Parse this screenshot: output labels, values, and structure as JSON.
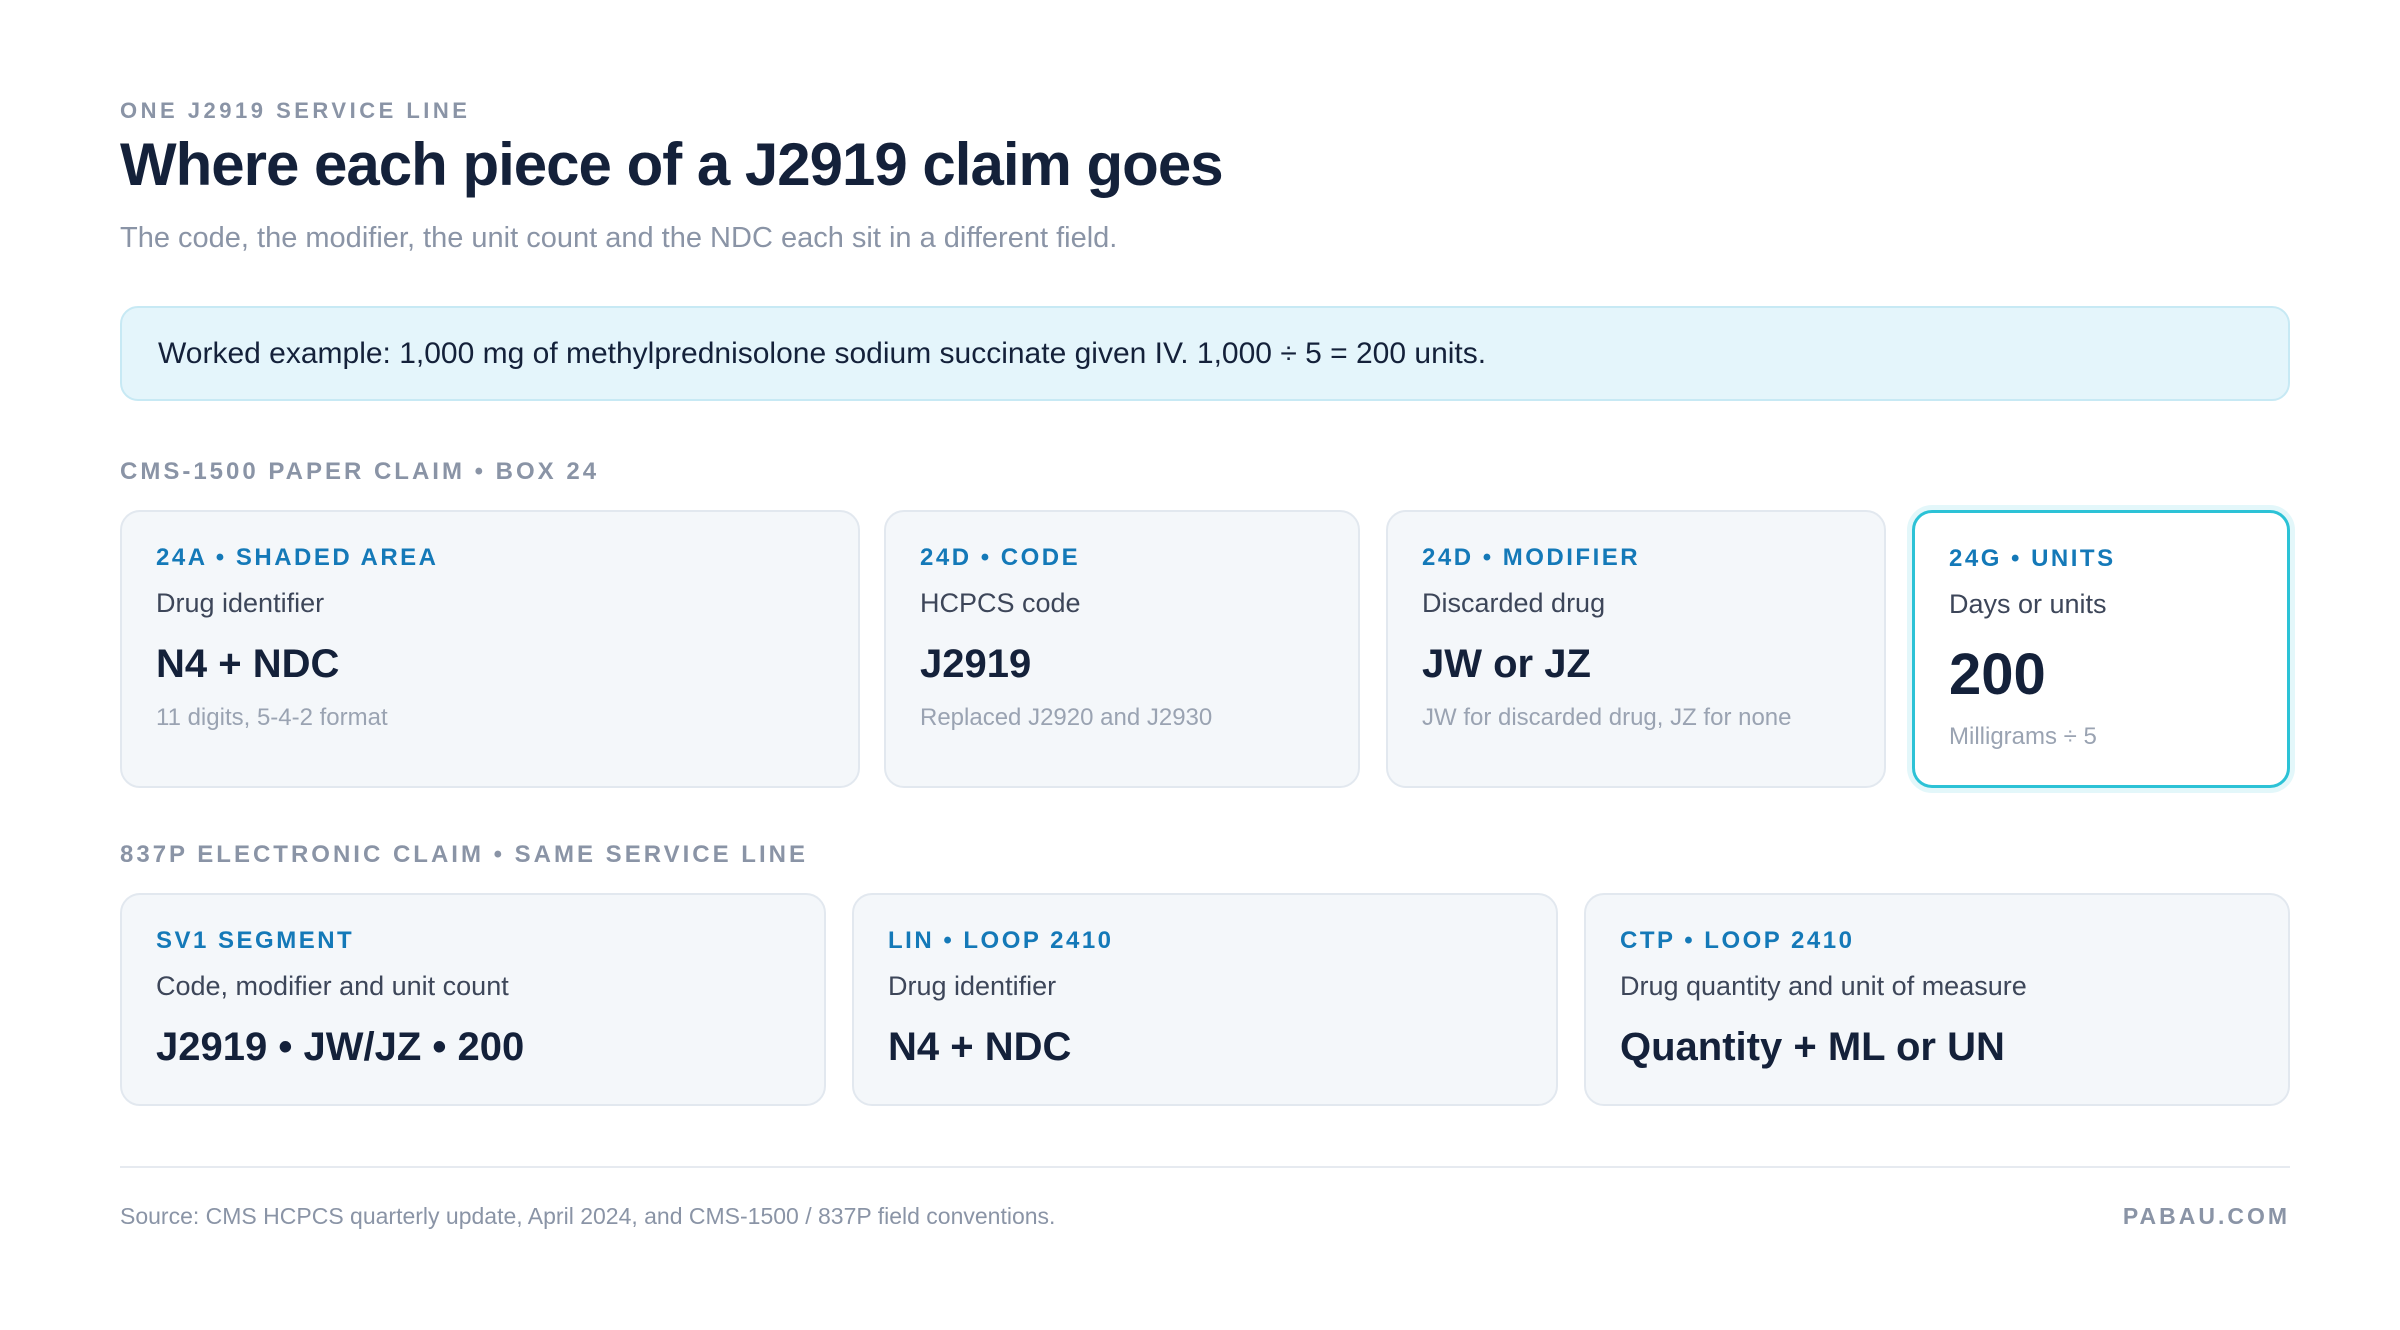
{
  "header": {
    "eyebrow": "ONE J2919 SERVICE LINE",
    "title": "Where each piece of a J2919 claim goes",
    "subtitle": "The code, the modifier, the unit count and the NDC each sit in a different field."
  },
  "callout": {
    "text": "Worked example: 1,000 mg of methylprednisolone sodium succinate given IV. 1,000 ÷ 5 = 200 units."
  },
  "paper_claim": {
    "section_label": "CMS-1500 PAPER CLAIM • BOX 24",
    "cards": [
      {
        "tag": "24A • SHADED AREA",
        "label": "Drug identifier",
        "value": "N4 + NDC",
        "note": "11 digits, 5-4-2 format"
      },
      {
        "tag": "24D • CODE",
        "label": "HCPCS code",
        "value": "J2919",
        "note": "Replaced J2920 and J2930"
      },
      {
        "tag": "24D • MODIFIER",
        "label": "Discarded drug",
        "value": "JW or JZ",
        "note": "JW for discarded drug, JZ for none"
      },
      {
        "tag": "24G • UNITS",
        "label": "Days or units",
        "value": "200",
        "note": "Milligrams ÷ 5"
      }
    ]
  },
  "electronic_claim": {
    "section_label": "837P ELECTRONIC CLAIM • SAME SERVICE LINE",
    "cards": [
      {
        "tag": "SV1 SEGMENT",
        "label": "Code, modifier and unit count",
        "value": "J2919 • JW/JZ • 200"
      },
      {
        "tag": "LIN • LOOP 2410",
        "label": "Drug identifier",
        "value": "N4 + NDC"
      },
      {
        "tag": "CTP • LOOP 2410",
        "label": "Drug quantity and unit of measure",
        "value": "Quantity + ML or UN"
      }
    ]
  },
  "footer": {
    "source": "Source: CMS HCPCS quarterly update, April 2024, and CMS-1500 / 837P field conventions.",
    "brand": "PABAU.COM"
  },
  "colors": {
    "accent_tag": "#1479b8",
    "highlight_border": "#2cc2d6",
    "callout_bg": "#e4f5fb",
    "title": "#14213a",
    "muted": "#8a94a6"
  }
}
